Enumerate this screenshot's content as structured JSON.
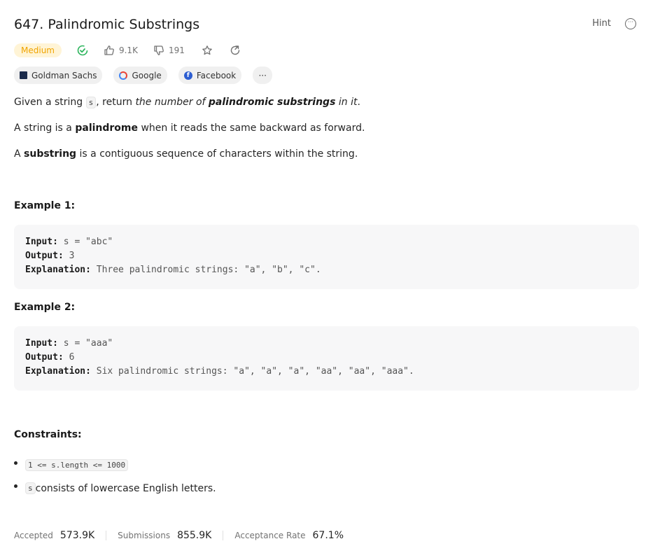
{
  "header": {
    "title": "647. Palindromic Substrings",
    "hint_label": "Hint"
  },
  "meta": {
    "difficulty": "Medium",
    "likes": "9.1K",
    "dislikes": "191"
  },
  "tags": [
    {
      "label": "Goldman Sachs"
    },
    {
      "label": "Google"
    },
    {
      "label": "Facebook"
    }
  ],
  "more_tags_label": "···",
  "description": {
    "p1": {
      "a": "Given a string ",
      "code": "s",
      "b": ", return ",
      "c": "the number of ",
      "d": "palindromic substrings",
      "e": " in it",
      "f": "."
    },
    "p2": {
      "a": "A string is a ",
      "b": "palindrome",
      "c": " when it reads the same backward as forward."
    },
    "p3": {
      "a": "A ",
      "b": "substring",
      "c": " is a contiguous sequence of characters within the string."
    }
  },
  "examples": [
    {
      "heading": "Example 1:",
      "input_label": "Input:",
      "input_value": "s = \"abc\"",
      "output_label": "Output:",
      "output_value": "3",
      "explanation_label": "Explanation:",
      "explanation_value": "Three palindromic strings: \"a\", \"b\", \"c\"."
    },
    {
      "heading": "Example 2:",
      "input_label": "Input:",
      "input_value": "s = \"aaa\"",
      "output_label": "Output:",
      "output_value": "6",
      "explanation_label": "Explanation:",
      "explanation_value": "Six palindromic strings: \"a\", \"a\", \"a\", \"aa\", \"aa\", \"aaa\"."
    }
  ],
  "constraints": {
    "heading": "Constraints:",
    "items": [
      {
        "code": "1 <= s.length <= 1000",
        "text": ""
      },
      {
        "code": "s",
        "text": " consists of lowercase English letters."
      }
    ]
  },
  "stats": {
    "accepted_label": "Accepted",
    "accepted_value": "573.9K",
    "submissions_label": "Submissions",
    "submissions_value": "855.9K",
    "rate_label": "Acceptance Rate",
    "rate_value": "67.1%"
  },
  "colors": {
    "medium": "#f0a400",
    "solved": "#2db55d",
    "code_bg": "#f7f7f8"
  }
}
